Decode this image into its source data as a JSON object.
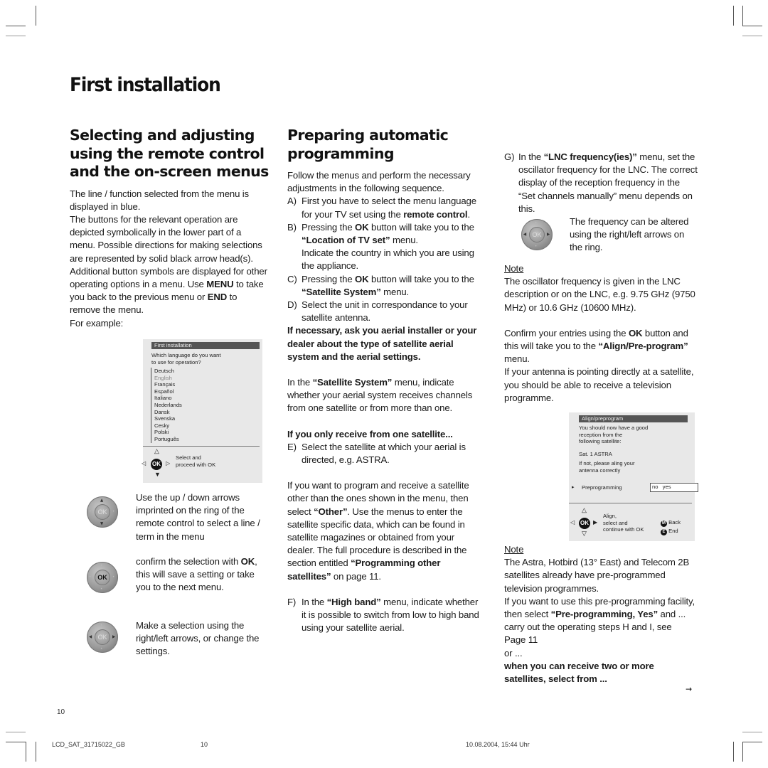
{
  "page": {
    "title": "First installation",
    "page_number": "10"
  },
  "col1": {
    "heading": "Selecting and adjusting using the remote control and the on-screen menus",
    "heading_lines": [
      "Selecting and adjusting",
      "using the remote control",
      "and the on-screen menus"
    ],
    "p1": "The line / function selected from the menu is displayed in blue.",
    "p2_a": "The buttons for the relevant operation are depicted symbolically in the lower part of a menu. Possible directions for making selections are represented by solid black arrow head(s). Additional button symbols are displayed for other operating options in a menu. Use ",
    "p2_menu": "MENU",
    "p2_b": " to take you back to the previous menu or ",
    "p2_end": "END",
    "p2_c": " to remove the menu.",
    "p3": "For example:",
    "example_menu": {
      "header": "First installation",
      "question": "Which language do you want to use for operation?",
      "question_lines": [
        "Which language do you want",
        "to use for operation?"
      ],
      "languages": [
        "Deutsch",
        "English",
        "Français",
        "Español",
        "Italiano",
        "Nederlands",
        "Dansk",
        "Svenska",
        "Cesky",
        "Polski",
        "Português"
      ],
      "selected_language": "English",
      "hint_line1": "Select and",
      "hint_line2": "proceed with OK",
      "ok_label": "OK"
    },
    "remote_tips": [
      {
        "icon": "remote-ring-up-down-icon",
        "ok_label": "OK",
        "text": "Use the up / down arrows imprinted on the ring of the remote control to select a line / term in the menu"
      },
      {
        "icon": "remote-ring-ok-icon",
        "ok_label": "OK",
        "text_a": "confirm the selection with ",
        "text_bold": "OK",
        "text_b": ", this will save a setting or take you to the next menu."
      },
      {
        "icon": "remote-ring-left-right-icon",
        "ok_label": "OK",
        "text": "Make a selection using the right/left arrows, or change the settings."
      }
    ]
  },
  "col2": {
    "heading_lines": [
      "Preparing automatic",
      "programming"
    ],
    "intro": "Follow the menus and perform the necessary adjustments in the following sequence.",
    "steps": {
      "A": {
        "label": "A)",
        "text_a": "First you have to select the menu language for your TV set using the ",
        "bold": "remote control",
        "text_b": "."
      },
      "B": {
        "label": "B)",
        "text_a": "Pressing the ",
        "bold1": "OK",
        "text_b": " button will take you to the ",
        "bold2": "“Location of TV set”",
        "text_c": " menu.",
        "text_d": "Indicate the country in which you are using the appliance."
      },
      "C": {
        "label": "C)",
        "text_a": "Pressing the ",
        "bold1": "OK",
        "text_b": " button will take you to the ",
        "bold2": "“Satellite System”",
        "text_c": " menu."
      },
      "D": {
        "label": "D)",
        "text": "Select the unit in correspondance to your satellite antenna."
      }
    },
    "warning": "If necessary, ask you aerial installer or your dealer about the type of satellite aerial system and the aerial settings.",
    "sat_system_a": "In the ",
    "sat_system_bold": "“Satellite System”",
    "sat_system_b": " menu, indicate whether your aerial system receives channels from one satellite or from more than one.",
    "one_sat_heading": "If you only receive from one satellite...",
    "step_E": {
      "label": "E)",
      "text": "Select the satellite at which your aerial is directed, e.g. ASTRA."
    },
    "other_a": "If you want to program and receive a satellite other than the ones shown in the menu, then select ",
    "other_bold": "“Other”",
    "other_b": ". Use the menus to enter the satellite specific data, which can be found in satellite magazines or obtained from your dealer. The full procedure is described in the section entitled ",
    "other_bold2": "“Programming  other satellites”",
    "other_c": " on page 11.",
    "step_F": {
      "label": "F)",
      "text_a": "In the ",
      "bold": "“High band”",
      "text_b": " menu, indicate whether it is possible to switch from low to high band using your satellite aerial."
    }
  },
  "col3": {
    "step_G": {
      "label": "G)",
      "text_a": "In the ",
      "bold": "“LNC frequency(ies)”",
      "text_b": " menu, set the oscillator frequency for the LNC. The correct display of the reception frequency in the “Set channels manually” menu depends on this."
    },
    "freq_tip": "The frequency can be altered using the right/left arrows on the ring.",
    "note1_title": "Note",
    "note1_text": "The oscillator frequency is given in the LNC description or on the LNC, e.g. 9.75 GHz (9750 MHz) or 10.6 GHz (10600 MHz).",
    "confirm_a": "Confirm your entries using the ",
    "confirm_bold1": "OK",
    "confirm_b": " button and this will take you to the ",
    "confirm_bold2": "“Align/Pre-program”",
    "confirm_c": " menu.",
    "antenna": "If your antenna is pointing directly at a satellite, you should be able to receive a television programme.",
    "align_menu": {
      "header": "Align/preprogram",
      "msg_lines": [
        "You should now have a good",
        "reception from the",
        "following satellite:"
      ],
      "satellite": "Sat. 1 ASTRA",
      "ifnot_lines": [
        "If not,  please aling your",
        "antenna correctly"
      ],
      "preprog_label": "Preprogramming",
      "preprog_options": "no   yes",
      "hint_lines": [
        "Align,",
        "select  and",
        "continue with OK"
      ],
      "ok_label": "OK",
      "back_key": "M",
      "back_label": "Back",
      "end_key": "E",
      "end_label": "End"
    },
    "note2_title": "Note",
    "note2_text": "The Astra, Hotbird (13° East) and Telecom 2B satellites already have pre-programmed television programmes.",
    "preprog_a": "If you want to use this pre-programming facility, then select ",
    "preprog_bold": "“Pre-programming, Yes”",
    "preprog_b": " and ...",
    "carry": "carry out the operating steps H and I, see Page 11",
    "or": "or ...",
    "two_more": "when you can receive two or more satellites, select from ...",
    "continue_arrow": "→"
  },
  "footer": {
    "file": "LCD_SAT_31715022_GB",
    "page": "10",
    "timestamp": "10.08.2004, 15:44 Uhr"
  }
}
